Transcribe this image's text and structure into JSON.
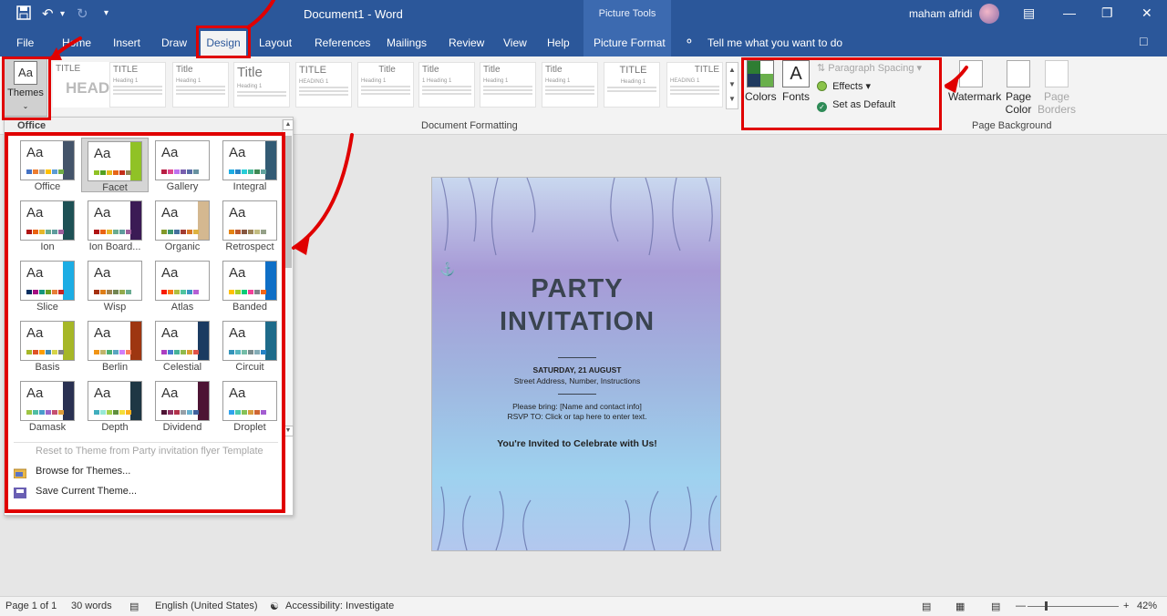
{
  "titlebar": {
    "doc_title": "Document1  -  Word",
    "context_header": "Picture Tools",
    "user_name": "maham afridi",
    "save_icon": "save-icon",
    "undo_icon": "undo-icon",
    "redo_icon": "redo-icon",
    "customize_icon": "customize-qat-icon"
  },
  "tabs": [
    "File",
    "Home",
    "Insert",
    "Draw",
    "Design",
    "Layout",
    "References",
    "Mailings",
    "Review",
    "View",
    "Help",
    "Picture Format"
  ],
  "tell_me": "Tell me what you want to do",
  "ribbon": {
    "themes_label": "Themes",
    "format_thumbs": [
      {
        "title": "TITLE",
        "heading": ""
      },
      {
        "title": "TITLE",
        "heading": "Heading 1"
      },
      {
        "title": "Title",
        "heading": "Heading 1"
      },
      {
        "title": "Title",
        "heading": "Heading 1"
      },
      {
        "title": "TITLE",
        "heading": "HEADING 1"
      },
      {
        "title": "Title",
        "heading": "Heading 1"
      },
      {
        "title": "Title",
        "heading": "1  Heading 1"
      },
      {
        "title": "Title",
        "heading": "Heading 1"
      },
      {
        "title": "Title",
        "heading": "Heading 1"
      },
      {
        "title": "TITLE",
        "heading": "Heading 1"
      },
      {
        "title": "TITLE",
        "heading": "HEADING 1"
      }
    ],
    "head_preview": "HEAD",
    "document_formatting_label": "Document Formatting",
    "colors_label": "Colors",
    "fonts_label": "Fonts",
    "fonts_glyph": "A",
    "paragraph_spacing_label": "Paragraph Spacing",
    "effects_label": "Effects",
    "set_default_label": "Set as Default",
    "watermark_label": "Watermark",
    "page_color_label": "Page Color",
    "page_borders_label": "Page Borders",
    "page_background_label": "Page Background"
  },
  "themes_panel": {
    "section_header": "Office",
    "themes": [
      {
        "name": "Office",
        "colors": [
          "#4472c4",
          "#ed7d31",
          "#a5a5a5",
          "#ffc000",
          "#5b9bd5",
          "#70ad47"
        ],
        "accent": "#44546a"
      },
      {
        "name": "Facet",
        "colors": [
          "#90c226",
          "#54a021",
          "#e6b91e",
          "#e76618",
          "#c42f1a",
          "#918655"
        ],
        "accent": "#90c226"
      },
      {
        "name": "Gallery",
        "colors": [
          "#b71e42",
          "#de478e",
          "#bc72f0",
          "#795faf",
          "#586ea6",
          "#6892a0"
        ],
        "accent": "#ffffff"
      },
      {
        "name": "Integral",
        "colors": [
          "#1cade4",
          "#2683c6",
          "#27ced7",
          "#42ba97",
          "#3e8853",
          "#62a39f"
        ],
        "accent": "#335b74"
      },
      {
        "name": "Ion",
        "colors": [
          "#b01513",
          "#ea6312",
          "#e6b729",
          "#6aac90",
          "#5f9c9d",
          "#9e5e9b"
        ],
        "accent": "#1e5155"
      },
      {
        "name": "Ion Board...",
        "colors": [
          "#b01513",
          "#ea6312",
          "#e6b729",
          "#6aac90",
          "#5f9c9d",
          "#9e5e9b"
        ],
        "accent": "#3b1b55"
      },
      {
        "name": "Organic",
        "colors": [
          "#83992a",
          "#3c9770",
          "#44709d",
          "#a23c33",
          "#d97828",
          "#deb340"
        ],
        "accent": "#d4b890"
      },
      {
        "name": "Retrospect",
        "colors": [
          "#e48312",
          "#bd582c",
          "#865640",
          "#9b8357",
          "#c2bc80",
          "#94a088"
        ],
        "accent": "#ffffff"
      },
      {
        "name": "Slice",
        "colors": [
          "#052f61",
          "#a50e82",
          "#14967c",
          "#6a9e1f",
          "#e87d37",
          "#c62324"
        ],
        "accent": "#1cade4"
      },
      {
        "name": "Wisp",
        "colors": [
          "#a53010",
          "#de7e18",
          "#9f8351",
          "#728653",
          "#92aa4c",
          "#6aac91"
        ],
        "accent": "#ffffff"
      },
      {
        "name": "Atlas",
        "colors": [
          "#f81b02",
          "#fc7715",
          "#afbf41",
          "#50c49f",
          "#3b95c4",
          "#b560d4"
        ],
        "accent": "#ffffff"
      },
      {
        "name": "Banded",
        "colors": [
          "#ffc000",
          "#a5d028",
          "#08cc78",
          "#f24099",
          "#828288",
          "#f56617"
        ],
        "accent": "#0f6fc6"
      },
      {
        "name": "Basis",
        "colors": [
          "#a6b727",
          "#df5327",
          "#fe9e00",
          "#418ab3",
          "#d7d447",
          "#818183"
        ],
        "accent": "#a6b727"
      },
      {
        "name": "Berlin",
        "colors": [
          "#f09415",
          "#c1b56b",
          "#4baf73",
          "#5aa6c0",
          "#d17df9",
          "#fa7e5c"
        ],
        "accent": "#9e3611"
      },
      {
        "name": "Celestial",
        "colors": [
          "#ac3ec1",
          "#477bd1",
          "#46b298",
          "#90ba4c",
          "#dd9d31",
          "#e25247"
        ],
        "accent": "#1b3b61"
      },
      {
        "name": "Circuit",
        "colors": [
          "#3494ba",
          "#58b6c0",
          "#75bda7",
          "#7a8c8e",
          "#84acb6",
          "#2683c6"
        ],
        "accent": "#1e6b8a"
      },
      {
        "name": "Damask",
        "colors": [
          "#9ec544",
          "#50bea3",
          "#4a9ccc",
          "#9a66ca",
          "#c54f71",
          "#de9c3c"
        ],
        "accent": "#2a3152"
      },
      {
        "name": "Depth",
        "colors": [
          "#41aebd",
          "#97e9d5",
          "#a2cf49",
          "#608f3d",
          "#f4de3a",
          "#fcb11c"
        ],
        "accent": "#1e3744"
      },
      {
        "name": "Dividend",
        "colors": [
          "#4d1434",
          "#903163",
          "#b2324b",
          "#969fa7",
          "#66b1ce",
          "#40619d"
        ],
        "accent": "#4d1434"
      },
      {
        "name": "Droplet",
        "colors": [
          "#2fa3ee",
          "#4bcaad",
          "#86c157",
          "#d99c3f",
          "#ce6633",
          "#a35dd1"
        ],
        "accent": "#ffffff"
      }
    ],
    "reset_label": "Reset to Theme from Party invitation flyer Template",
    "browse_label": "Browse for Themes...",
    "save_label": "Save Current Theme..."
  },
  "document": {
    "title_line1": "PARTY",
    "title_line2": "INVITATION",
    "date": "SATURDAY, 21 AUGUST",
    "address": "Street Address, Number, Instructions",
    "bring": "Please bring: [Name and contact info]",
    "rsvp": "RSVP TO: Click or tap here to enter text.",
    "invite": "You're Invited to Celebrate with Us!"
  },
  "statusbar": {
    "page": "Page 1 of 1",
    "words": "30 words",
    "language": "English (United States)",
    "accessibility": "Accessibility: Investigate",
    "zoom": "42%"
  },
  "colors": {
    "word_blue": "#2b579a",
    "annotation_red": "#e00000"
  }
}
